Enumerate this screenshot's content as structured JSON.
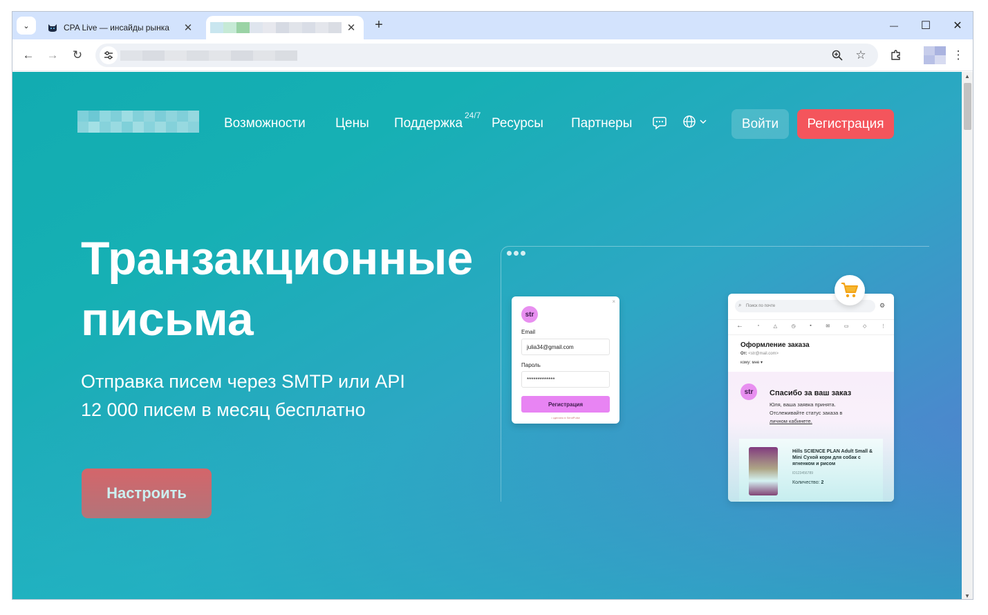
{
  "browser": {
    "tabs": [
      {
        "title": "CPA Live — инсайды рынка",
        "close": "✕"
      },
      {
        "title": "",
        "close": "✕"
      }
    ],
    "new_tab": "+",
    "window_controls": {
      "minimize": "—",
      "maximize": "☐",
      "close": "✕"
    },
    "toolbar": {
      "back": "←",
      "forward": "→",
      "reload": "↻",
      "menu": "⋮"
    }
  },
  "site": {
    "nav": {
      "features": "Возможности",
      "prices": "Цены",
      "support": "Поддержка",
      "support_sup": "24/7",
      "resources": "Ресурсы",
      "partners": "Партнеры"
    },
    "login": "Войти",
    "register": "Регистрация",
    "hero": {
      "title_line1": "Транзакционные",
      "title_line2": "письма",
      "subtitle_line1": "Отправка писем через SMTP или API",
      "subtitle_line2": "12 000 писем в месяц бесплатно",
      "cta": "Настроить"
    },
    "mock_form": {
      "badge": "str",
      "close": "×",
      "email_label": "Email",
      "email_value": "julia34@gmail.com",
      "password_label": "Пароль",
      "password_value": "*************",
      "button": "Регистрация",
      "footer": "• сделано в SendPulse"
    },
    "mock_mail": {
      "search_placeholder": "Поиск по почте",
      "subject": "Оформление заказа",
      "from_label": "От:",
      "from_value": "<str@mail.com>",
      "to": "кому: мне ▾",
      "badge": "str",
      "thanks": "Спасибо за ваш заказ",
      "text_line1": "Юля, ваша заявка принята.",
      "text_line2": "Отслеживайте статус заказа в",
      "text_link": "личном кабинете.",
      "product_name": "Hills SCIENCE PLAN Adult Small & Mini Сухой корм для собак с ягненком и рисом",
      "product_id": "ID123456789",
      "qty_label": "Количество:",
      "qty_value": "2"
    }
  },
  "colors": {
    "accent_red": "#f4555c",
    "mock_pink": "#e884f3",
    "bg_teal": "#12acb1",
    "bg_blue": "#5375c9"
  }
}
